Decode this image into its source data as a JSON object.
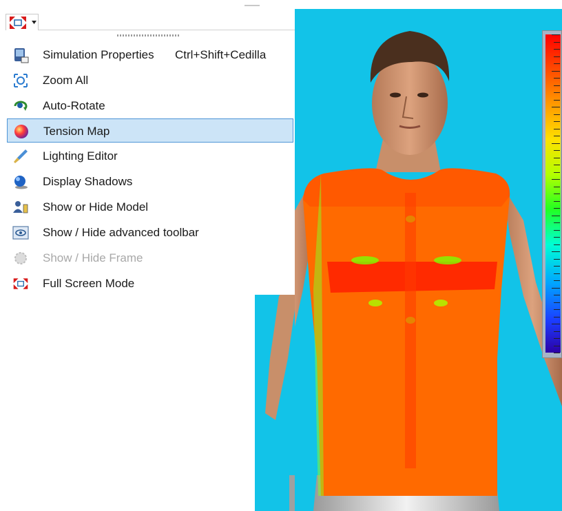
{
  "toolbar": {
    "fullscreen_dropdown": {
      "icon": "fullscreen-icon",
      "caret_icon": "caret-down-icon"
    }
  },
  "menu": {
    "items": [
      {
        "label": "Simulation Properties",
        "shortcut": "Ctrl+Shift+Cedilla",
        "icon": "simulation-properties-icon",
        "highlighted": false,
        "enabled": true
      },
      {
        "label": "Zoom All",
        "icon": "zoom-all-icon",
        "highlighted": false,
        "enabled": true
      },
      {
        "label": "Auto-Rotate",
        "icon": "auto-rotate-icon",
        "highlighted": false,
        "enabled": true
      },
      {
        "label": "Tension Map",
        "icon": "tension-map-icon",
        "highlighted": true,
        "enabled": true
      },
      {
        "label": "Lighting Editor",
        "icon": "lighting-editor-icon",
        "highlighted": false,
        "enabled": true
      },
      {
        "label": "Display Shadows",
        "icon": "display-shadows-icon",
        "highlighted": false,
        "enabled": true
      },
      {
        "label": "Show or Hide Model",
        "icon": "show-hide-model-icon",
        "highlighted": false,
        "enabled": true
      },
      {
        "label": "Show / Hide advanced toolbar",
        "icon": "advanced-toolbar-icon",
        "highlighted": false,
        "enabled": true
      },
      {
        "label": "Show / Hide Frame",
        "icon": "frame-icon",
        "highlighted": false,
        "enabled": false
      },
      {
        "label": "Full Screen Mode",
        "icon": "fullscreen-icon",
        "highlighted": false,
        "enabled": true
      }
    ]
  },
  "viewport": {
    "background_color": "#12c3e8",
    "garment": "shirt-tension-map",
    "model": "male-avatar"
  },
  "tension_scale": {
    "colors": [
      "#ff0000",
      "#ff9a00",
      "#ffe000",
      "#22ff22",
      "#00ffd4",
      "#00a6ff",
      "#2c00a6"
    ]
  }
}
